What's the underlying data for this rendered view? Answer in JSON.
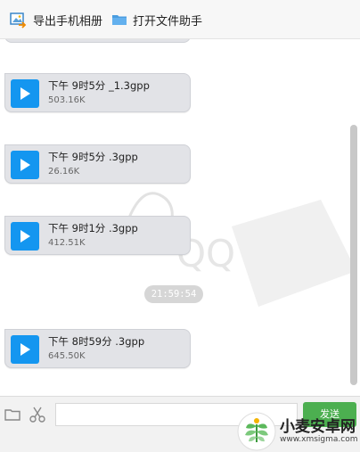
{
  "toolbar": {
    "export_label": "导出手机相册",
    "open_label": "打开文件助手"
  },
  "messages": [
    {
      "name": "下午 9时5分 _1.3gpp",
      "size": "503.16K"
    },
    {
      "name": "下午 9时5分 .3gpp",
      "size": "26.16K"
    },
    {
      "name": "下午 9时1分 .3gpp",
      "size": "412.51K"
    },
    {
      "name": "下午 8时59分 .3gpp",
      "size": "645.50K"
    }
  ],
  "background_logo": "QQ",
  "timestamp": "21:59:54",
  "input": {
    "value": "",
    "placeholder": ""
  },
  "send_label": "发送",
  "watermark": {
    "title": "小麦安卓网",
    "url": "www.xmsigma.com"
  },
  "colors": {
    "play": "#1496f0",
    "bubble": "#e2e3e7",
    "send": "#4caf50"
  }
}
